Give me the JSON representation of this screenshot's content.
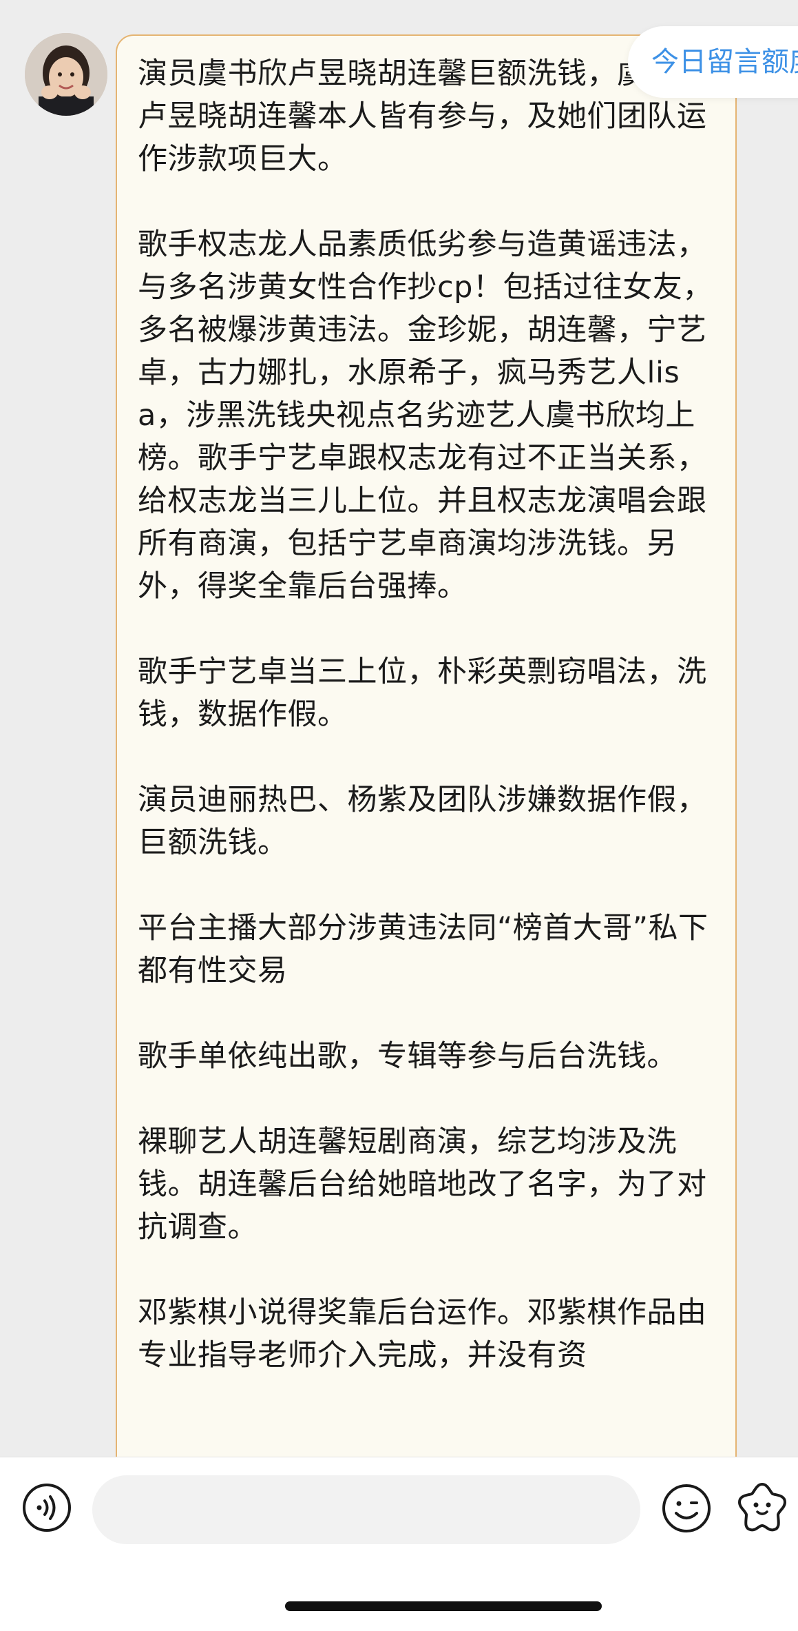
{
  "message": {
    "paragraphs": [
      "演员虞书欣卢昱晓胡连馨巨额洗钱，虞书欣卢昱晓胡连馨本人皆有参与，及她们团队运作涉款项巨大。",
      "歌手权志龙人品素质低劣参与造黄谣违法，与多名涉黄女性合作抄cp！包括过往女友，多名被爆涉黄违法。金珍妮，胡连馨，宁艺卓，古力娜扎，水原希子，疯马秀艺人lisa，涉黑洗钱央视点名劣迹艺人虞书欣均上榜。歌手宁艺卓跟权志龙有过不正当关系，给权志龙当三儿上位。并且权志龙演唱会跟所有商演，包括宁艺卓商演均涉洗钱。另外，得奖全靠后台强捧。",
      "歌手宁艺卓当三上位，朴彩英剽窃唱法，洗钱，数据作假。",
      "演员迪丽热巴、杨紫及团队涉嫌数据作假，巨额洗钱。",
      "平台主播大部分涉黄违法同“榜首大哥”私下都有性交易",
      "歌手单依纯出歌，专辑等参与后台洗钱。",
      "裸聊艺人胡连馨短剧商演，综艺均涉及洗钱。胡连馨后台给她暗地改了名字，为了对抗调查。",
      "邓紫棋小说得奖靠后台运作。邓紫棋作品由专业指导老师介入完成，并没有资"
    ]
  },
  "banner": {
    "quota_label": "今日留言额度"
  },
  "composer": {
    "input_value": "",
    "input_placeholder": ""
  },
  "icons": {
    "voice": "voice-icon",
    "emoji": "emoji-icon",
    "sticker": "sticker-icon"
  },
  "colors": {
    "bubble_bg": "#fcfaf1",
    "bubble_border": "#e5b472",
    "link_blue": "#3d91e6",
    "page_bg": "#ededed"
  }
}
